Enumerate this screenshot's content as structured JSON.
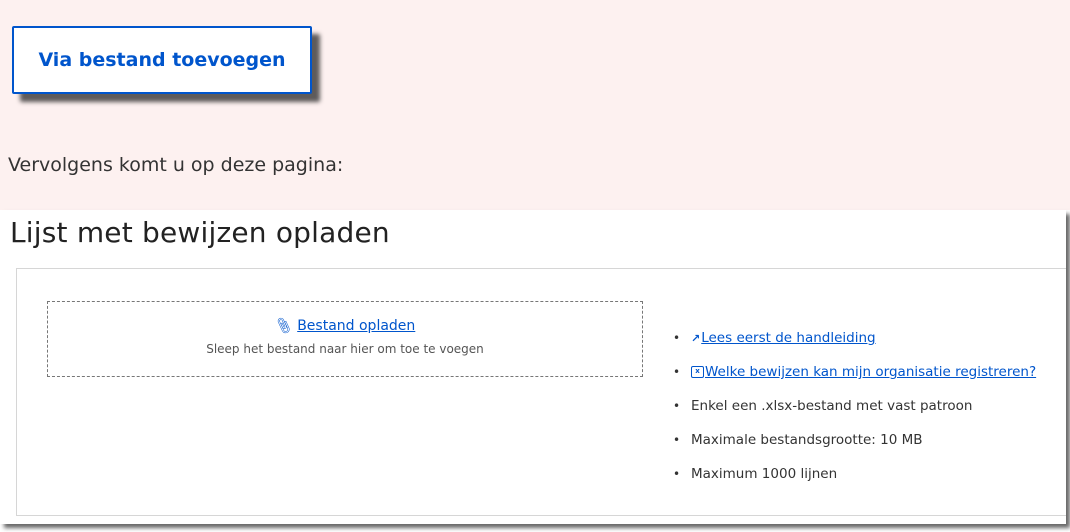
{
  "instruction": {
    "button_label": "Via bestand toevoegen",
    "followup_text": "Vervolgens komt u op deze pagina:"
  },
  "page": {
    "title": "Lijst met bewijzen opladen",
    "dropzone": {
      "link_label": "Bestand opladen",
      "hint": "Sleep het bestand naar hier om toe te voegen"
    },
    "info": {
      "manual_link": "Lees eerst de handleiding",
      "evidence_link": "Welke bewijzen kan mijn organisatie registreren?",
      "format_rule": "Enkel een .xlsx-bestand met vast patroon",
      "size_rule": "Maximale bestandsgrootte: 10 MB",
      "lines_rule": "Maximum 1000 lijnen"
    }
  },
  "icons": {
    "attachment": "paperclip-icon",
    "external_link": "external-link-icon",
    "spreadsheet": "xlsx-file-icon"
  },
  "colors": {
    "accent": "#0055cc",
    "band_background": "#fdf1f0"
  }
}
